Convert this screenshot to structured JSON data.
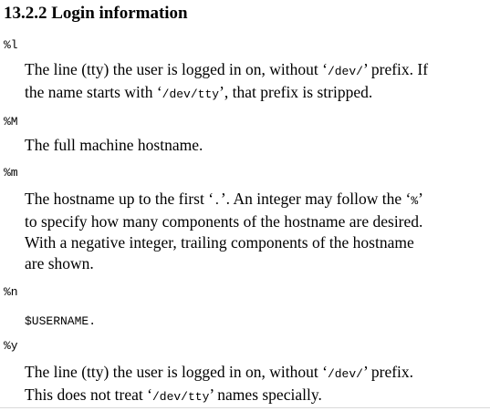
{
  "section": {
    "title": "13.2.2 Login information"
  },
  "entries": [
    {
      "term": "%l",
      "lines": [
        [
          {
            "text": "The line (tty) the user is logged in on, without ‘",
            "mono": false
          },
          {
            "text": "/dev/",
            "mono": true
          },
          {
            "text": "’ prefix. If",
            "mono": false
          }
        ],
        [
          {
            "text": "the name starts with ‘",
            "mono": false
          },
          {
            "text": "/dev/tty",
            "mono": true
          },
          {
            "text": "’, that prefix is stripped.",
            "mono": false
          }
        ]
      ]
    },
    {
      "term": "%M",
      "lines": [
        [
          {
            "text": "The full machine hostname.",
            "mono": false
          }
        ]
      ]
    },
    {
      "term": "%m",
      "lines": [
        [
          {
            "text": "The hostname up to the first ‘",
            "mono": false
          },
          {
            "text": ".",
            "mono": true
          },
          {
            "text": "’. An integer may follow the ‘",
            "mono": false
          },
          {
            "text": "%",
            "mono": true
          },
          {
            "text": "’",
            "mono": false
          }
        ],
        [
          {
            "text": "to specify how many components of the hostname are desired.",
            "mono": false
          }
        ],
        [
          {
            "text": "With a negative integer, trailing components of the hostname",
            "mono": false
          }
        ],
        [
          {
            "text": "are shown.",
            "mono": false
          }
        ]
      ]
    },
    {
      "term": "%n",
      "lines": [
        [
          {
            "text": "$USERNAME.",
            "mono": true
          }
        ]
      ]
    },
    {
      "term": "%y",
      "lines": [
        [
          {
            "text": "The line (tty) the user is logged in on, without ‘",
            "mono": false
          },
          {
            "text": "/dev/",
            "mono": true
          },
          {
            "text": "’ prefix.",
            "mono": false
          }
        ],
        [
          {
            "text": "This does not treat ‘",
            "mono": false
          },
          {
            "text": "/dev/tty",
            "mono": true
          },
          {
            "text": "’ names specially.",
            "mono": false
          }
        ]
      ]
    }
  ]
}
